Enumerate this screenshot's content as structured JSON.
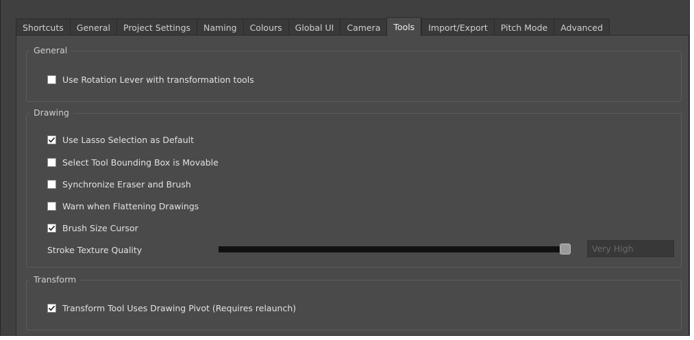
{
  "tabs": [
    {
      "label": "Shortcuts",
      "active": false
    },
    {
      "label": "General",
      "active": false
    },
    {
      "label": "Project Settings",
      "active": false
    },
    {
      "label": "Naming",
      "active": false
    },
    {
      "label": "Colours",
      "active": false
    },
    {
      "label": "Global UI",
      "active": false
    },
    {
      "label": "Camera",
      "active": false
    },
    {
      "label": "Tools",
      "active": true
    },
    {
      "label": "Import/Export",
      "active": false
    },
    {
      "label": "Pitch Mode",
      "active": false
    },
    {
      "label": "Advanced",
      "active": false
    }
  ],
  "groups": {
    "general": {
      "title": "General",
      "options": [
        {
          "label": "Use Rotation Lever with transformation tools",
          "checked": false
        }
      ]
    },
    "drawing": {
      "title": "Drawing",
      "options": [
        {
          "label": "Use Lasso Selection as Default",
          "checked": true
        },
        {
          "label": "Select Tool Bounding Box is Movable",
          "checked": false
        },
        {
          "label": "Synchronize Eraser and Brush",
          "checked": false
        },
        {
          "label": "Warn when Flattening Drawings",
          "checked": false
        },
        {
          "label": "Brush Size Cursor",
          "checked": true
        }
      ],
      "stroke_texture": {
        "label": "Stroke Texture Quality",
        "value_text": "Very High",
        "level": 1.0
      }
    },
    "transform": {
      "title": "Transform",
      "options": [
        {
          "label": "Transform Tool Uses Drawing Pivot (Requires relaunch)",
          "checked": true
        }
      ]
    }
  },
  "colors": {
    "window_bg": "#404040",
    "pane_bg": "#4a4a4a",
    "text": "#e2e2e2",
    "checkbox_bg": "#ffffff",
    "checkmark": "#2a2a2a"
  }
}
